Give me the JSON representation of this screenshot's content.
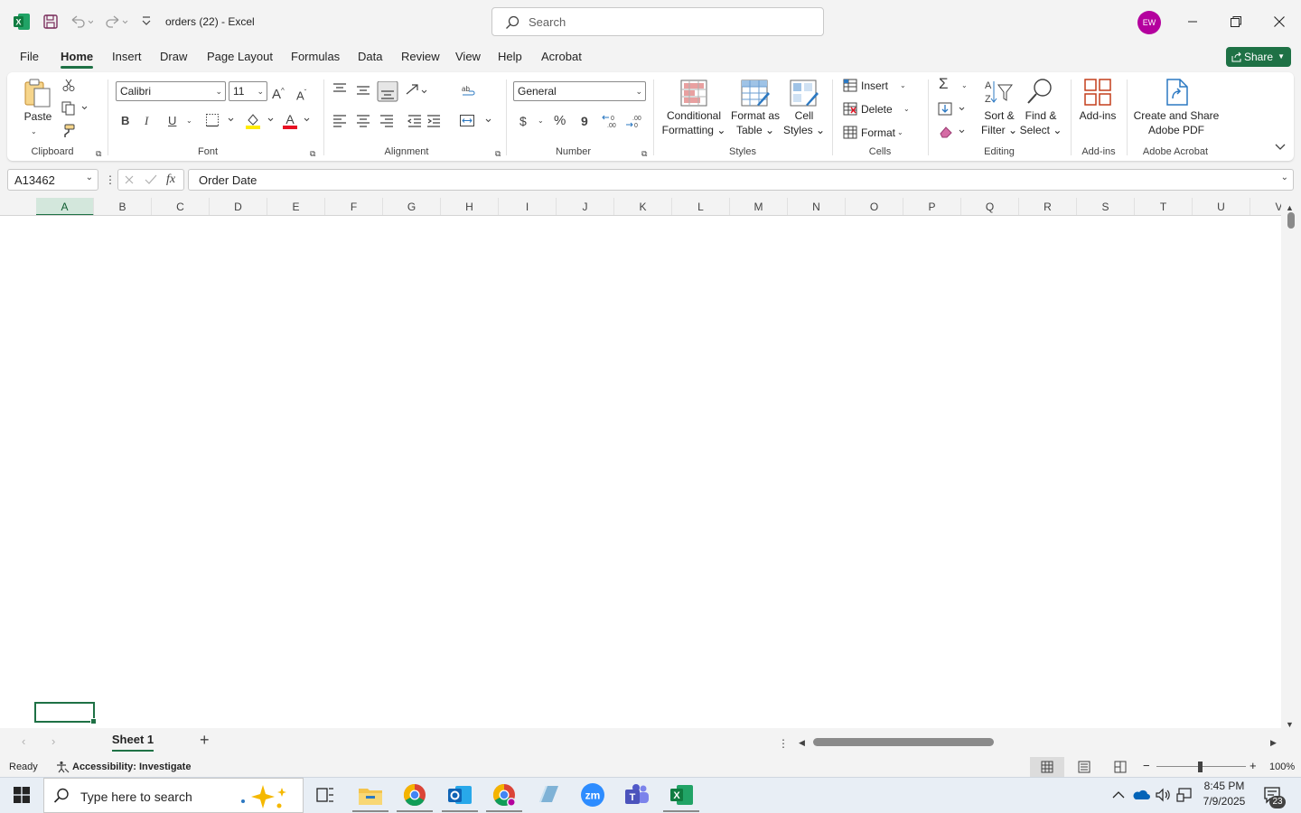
{
  "app": {
    "name": "Excel",
    "document": "orders (22)",
    "title_text": "orders (22)  -  Excel"
  },
  "search": {
    "placeholder": "Search"
  },
  "user": {
    "initials": "EW"
  },
  "menu": {
    "tabs": [
      "File",
      "Home",
      "Insert",
      "Draw",
      "Page Layout",
      "Formulas",
      "Data",
      "Review",
      "View",
      "Help",
      "Acrobat"
    ],
    "active": "Home",
    "share_label": "Share"
  },
  "ribbon": {
    "clipboard": {
      "label": "Clipboard",
      "paste": "Paste"
    },
    "font": {
      "label": "Font",
      "family": "Calibri",
      "size": "11",
      "bold": "B",
      "italic": "I",
      "underline": "U"
    },
    "alignment": {
      "label": "Alignment"
    },
    "number": {
      "label": "Number",
      "format": "General",
      "currency": "$",
      "percent": "%",
      "comma": "9"
    },
    "styles": {
      "label": "Styles",
      "conditional": "Conditional",
      "conditional2": "Formatting",
      "format_as": "Format as",
      "format_as2": "Table",
      "cell": "Cell",
      "cell2": "Styles"
    },
    "cells": {
      "label": "Cells",
      "insert": "Insert",
      "delete": "Delete",
      "format": "Format"
    },
    "editing": {
      "label": "Editing",
      "sort": "Sort &",
      "sort2": "Filter",
      "find": "Find &",
      "find2": "Select"
    },
    "addins": {
      "label": "Add-ins",
      "button": "Add-ins"
    },
    "acrobat": {
      "label": "Adobe Acrobat",
      "button": "Create and Share",
      "button2": "Adobe PDF"
    }
  },
  "formula_bar": {
    "name_box": "A13462",
    "fx": "fx",
    "content": "Order Date"
  },
  "grid": {
    "columns": [
      "A",
      "B",
      "C",
      "D",
      "E",
      "F",
      "G",
      "H",
      "I",
      "J",
      "K",
      "L",
      "M",
      "N",
      "O",
      "P",
      "Q",
      "R",
      "S",
      "T",
      "U",
      "V"
    ],
    "selected_column": "A"
  },
  "sheets": {
    "tabs": [
      "Sheet 1"
    ],
    "active": "Sheet 1"
  },
  "status": {
    "ready": "Ready",
    "accessibility": "Accessibility: Investigate",
    "zoom": "100%"
  },
  "taskbar": {
    "search_placeholder": "Type here to search",
    "time": "8:45 PM",
    "date": "7/9/2025",
    "notifications": "23"
  },
  "colors": {
    "accent": "#1e7145",
    "avatar": "#b4009e"
  }
}
